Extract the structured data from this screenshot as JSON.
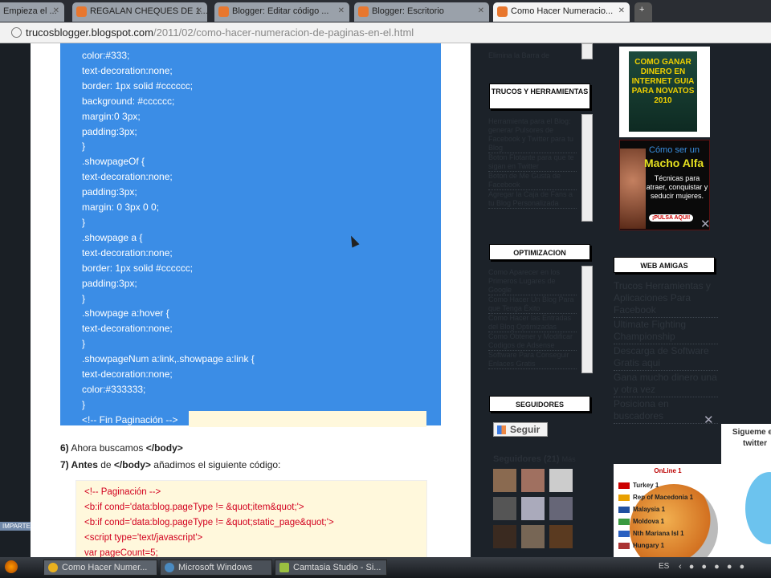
{
  "browser": {
    "tabs": [
      {
        "label": "Empieza el ..."
      },
      {
        "label": "REGALAN CHEQUES DE 1..."
      },
      {
        "label": "Blogger: Editar código ..."
      },
      {
        "label": "Blogger: Escritorio"
      },
      {
        "label": "Como Hacer Numeracio..."
      }
    ],
    "url_domain": "trucosblogger.blogspot.com",
    "url_path": "/2011/02/como-hacer-numeracion-de-paginas-en-el.html"
  },
  "main": {
    "selected_code": [
      "color:#333;",
      "text-decoration:none;",
      "border: 1px solid #cccccc;",
      "background: #cccccc;",
      "margin:0 3px;",
      "padding:3px;",
      "}",
      ".showpageOf {",
      "text-decoration:none;",
      "padding:3px;",
      "margin: 0 3px 0 0;",
      "}",
      ".showpage a {",
      "text-decoration:none;",
      "border: 1px solid #cccccc;",
      "padding:3px;",
      "}",
      ".showpage a:hover {",
      "text-decoration:none;",
      "}",
      ".showpageNum a:link,.showpage a:link {",
      "text-decoration:none;",
      "color:#333333;",
      "}",
      "<!-- Fin Paginación -->"
    ],
    "step6_num": "6)",
    "step6_text": " Ahora buscamos ",
    "step6_code": "</body>",
    "step7_num": "7) Antes",
    "step7_text": " de ",
    "step7_code": "</body>",
    "step7_rest": " añadimos el siguiente código:",
    "code2": [
      "<!-- Paginación -->",
      "<b:if cond='data:blog.pageType != &quot;item&quot;'>",
      "<b:if cond='data:blog.pageType != &quot;static_page&quot;'>",
      "<script type='text/javascript'>",
      "var pageCount=5;"
    ]
  },
  "sidebar": {
    "top_item": "Elimina la Barra de",
    "trucos_title": "TRUCOS Y HERRAMIENTAS",
    "trucos_items": [
      "Herramienta para el Blog: generar Pulsores de Facebook y Twitter para tu Blog",
      "Boton Flotante para que te sigan en Twitter",
      "Boton de Me Gusta de Facebook",
      "Agregar la Caja de Fans a tu Blog Personalizada"
    ],
    "optim_title": "OPTIMIZACION",
    "optim_items": [
      "Como Aparecer en los Primeros Lugares de Google",
      "Como Hacer Un Blog Para que Tenga Éxito",
      "Como Hacer las Entradas del Blog Optimizadas",
      "Como Obtener y Modificar Codigos de Adsense",
      "Software Para Conseguir Enlaces Gratis"
    ],
    "seguidores_title": "SEGUIDORES",
    "seguir_label": "Seguir",
    "followers_label": "Seguidores (21)",
    "followers_more": "Más",
    "ad1_text": "COMO GANAR DINERO EN INTERNET GUIA PARA NOVATOS 2010",
    "ad2": {
      "line1": "Cómo ser un",
      "line2": "Macho Alfa",
      "line3": "Técnicas para atraer, conquistar y seducir mujeres.",
      "button": "¡PULSA AQUI!"
    },
    "web_title": "WEB AMIGAS",
    "web_items": [
      "Trucos Herramientas y Aplicaciones Para Facebook",
      "Ultimate Fighting Championship",
      "Descarga de Software Gratis aqui",
      "Gana mucho dinero una y otra vez",
      "Posiciona en buscadores"
    ],
    "online": {
      "title": "OnLine 1",
      "countries": [
        "Turkey 1",
        "Rep of Macedonia 1",
        "Malaysia 1",
        "Moldova 1",
        "Nth Mariana Isl 1",
        "Hungary 1"
      ]
    },
    "twitter_text": "Sigueme en twitter"
  },
  "page_badge": "IMPARTELO",
  "taskbar": {
    "items": [
      "Como Hacer Numer...",
      "Microsoft Windows",
      "Camtasia Studio - Si..."
    ],
    "lang": "ES"
  }
}
